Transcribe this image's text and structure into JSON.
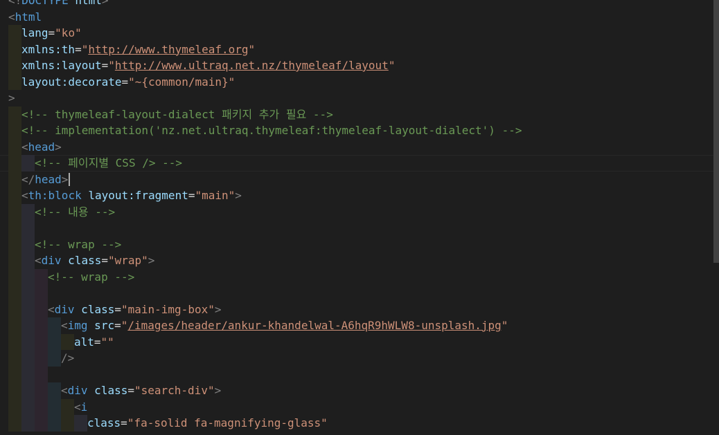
{
  "editor": {
    "language": "html",
    "current_line": 10,
    "colors": {
      "background": "#1e1e1e",
      "tag": "#569cd6",
      "attribute": "#9cdcfe",
      "string": "#ce9178",
      "comment": "#6a9955",
      "bracket": "#808080",
      "guide_level_1": "#2a2a1e",
      "guide_level_2": "#2b2b33",
      "guide_level_3": "#2d252e",
      "guide_level_4": "#232d33"
    },
    "lines": [
      {
        "indent": 0,
        "tokens": [
          {
            "t": "<!",
            "c": "bracket"
          },
          {
            "t": "DOCTYPE",
            "c": "tag"
          },
          {
            "t": " html",
            "c": "attr"
          },
          {
            "t": ">",
            "c": "bracket"
          }
        ]
      },
      {
        "indent": 0,
        "tokens": [
          {
            "t": "<",
            "c": "bracket"
          },
          {
            "t": "html",
            "c": "tag"
          }
        ]
      },
      {
        "indent": 1,
        "tokens": [
          {
            "t": "lang",
            "c": "attr"
          },
          {
            "t": "=",
            "c": "eq"
          },
          {
            "t": "\"ko\"",
            "c": "str"
          }
        ]
      },
      {
        "indent": 1,
        "tokens": [
          {
            "t": "xmlns:th",
            "c": "attr"
          },
          {
            "t": "=",
            "c": "eq"
          },
          {
            "t": "\"",
            "c": "str"
          },
          {
            "t": "http://www.thymeleaf.org",
            "c": "url"
          },
          {
            "t": "\"",
            "c": "str"
          }
        ]
      },
      {
        "indent": 1,
        "tokens": [
          {
            "t": "xmlns:layout",
            "c": "attr"
          },
          {
            "t": "=",
            "c": "eq"
          },
          {
            "t": "\"",
            "c": "str"
          },
          {
            "t": "http://www.ultraq.net.nz/thymeleaf/layout",
            "c": "url"
          },
          {
            "t": "\"",
            "c": "str"
          }
        ]
      },
      {
        "indent": 1,
        "tokens": [
          {
            "t": "layout:decorate",
            "c": "attr"
          },
          {
            "t": "=",
            "c": "eq"
          },
          {
            "t": "\"~{common/main}\"",
            "c": "str"
          }
        ]
      },
      {
        "indent": 0,
        "tokens": [
          {
            "t": ">",
            "c": "bracket"
          }
        ]
      },
      {
        "indent": 1,
        "tokens": [
          {
            "t": "<!-- thymeleaf-layout-dialect 패키지 추가 필요 -->",
            "c": "comment"
          }
        ]
      },
      {
        "indent": 1,
        "tokens": [
          {
            "t": "<!-- implementation('nz.net.ultraq.thymeleaf:thymeleaf-layout-dialect') -->",
            "c": "comment"
          }
        ]
      },
      {
        "indent": 1,
        "tokens": [
          {
            "t": "<",
            "c": "bracket"
          },
          {
            "t": "head",
            "c": "tag"
          },
          {
            "t": ">",
            "c": "bracket"
          }
        ]
      },
      {
        "indent": 2,
        "tokens": [
          {
            "t": "<!-- 페이지별 CSS /> -->",
            "c": "comment"
          }
        ]
      },
      {
        "indent": 1,
        "caret": true,
        "tokens": [
          {
            "t": "</",
            "c": "bracket"
          },
          {
            "t": "head",
            "c": "tag"
          },
          {
            "t": ">",
            "c": "bracket"
          }
        ]
      },
      {
        "indent": 1,
        "tokens": [
          {
            "t": "<",
            "c": "bracket"
          },
          {
            "t": "th:block",
            "c": "tag"
          },
          {
            "t": " layout:fragment",
            "c": "attr"
          },
          {
            "t": "=",
            "c": "eq"
          },
          {
            "t": "\"main\"",
            "c": "str"
          },
          {
            "t": ">",
            "c": "bracket"
          }
        ]
      },
      {
        "indent": 2,
        "tokens": [
          {
            "t": "<!-- 내용 -->",
            "c": "comment"
          }
        ]
      },
      {
        "indent": 2,
        "tokens": []
      },
      {
        "indent": 2,
        "tokens": [
          {
            "t": "<!-- wrap -->",
            "c": "comment"
          }
        ]
      },
      {
        "indent": 2,
        "tokens": [
          {
            "t": "<",
            "c": "bracket"
          },
          {
            "t": "div",
            "c": "tag"
          },
          {
            "t": " class",
            "c": "attr"
          },
          {
            "t": "=",
            "c": "eq"
          },
          {
            "t": "\"wrap\"",
            "c": "str"
          },
          {
            "t": ">",
            "c": "bracket"
          }
        ]
      },
      {
        "indent": 3,
        "tokens": [
          {
            "t": "<!-- wrap -->",
            "c": "comment"
          }
        ]
      },
      {
        "indent": 3,
        "tokens": []
      },
      {
        "indent": 3,
        "tokens": [
          {
            "t": "<",
            "c": "bracket"
          },
          {
            "t": "div",
            "c": "tag"
          },
          {
            "t": " class",
            "c": "attr"
          },
          {
            "t": "=",
            "c": "eq"
          },
          {
            "t": "\"main-img-box\"",
            "c": "str"
          },
          {
            "t": ">",
            "c": "bracket"
          }
        ]
      },
      {
        "indent": 4,
        "tokens": [
          {
            "t": "<",
            "c": "bracket"
          },
          {
            "t": "img",
            "c": "tag"
          },
          {
            "t": " src",
            "c": "attr"
          },
          {
            "t": "=",
            "c": "eq"
          },
          {
            "t": "\"",
            "c": "str"
          },
          {
            "t": "/images/header/ankur-khandelwal-A6hqR9hWLW8-unsplash.jpg",
            "c": "url"
          },
          {
            "t": "\"",
            "c": "str"
          }
        ]
      },
      {
        "indent": 5,
        "tokens": [
          {
            "t": "alt",
            "c": "attr"
          },
          {
            "t": "=",
            "c": "eq"
          },
          {
            "t": "\"\"",
            "c": "str"
          }
        ]
      },
      {
        "indent": 4,
        "tokens": [
          {
            "t": "/>",
            "c": "bracket"
          }
        ]
      },
      {
        "indent": 3,
        "tokens": []
      },
      {
        "indent": 4,
        "tokens": [
          {
            "t": "<",
            "c": "bracket"
          },
          {
            "t": "div",
            "c": "tag"
          },
          {
            "t": " class",
            "c": "attr"
          },
          {
            "t": "=",
            "c": "eq"
          },
          {
            "t": "\"search-div\"",
            "c": "str"
          },
          {
            "t": ">",
            "c": "bracket"
          }
        ]
      },
      {
        "indent": 5,
        "tokens": [
          {
            "t": "<",
            "c": "bracket"
          },
          {
            "t": "i",
            "c": "tag"
          }
        ]
      },
      {
        "indent": 6,
        "tokens": [
          {
            "t": "class",
            "c": "attr"
          },
          {
            "t": "=",
            "c": "eq"
          },
          {
            "t": "\"fa-solid fa-magnifying-glass\"",
            "c": "str"
          }
        ]
      }
    ]
  }
}
